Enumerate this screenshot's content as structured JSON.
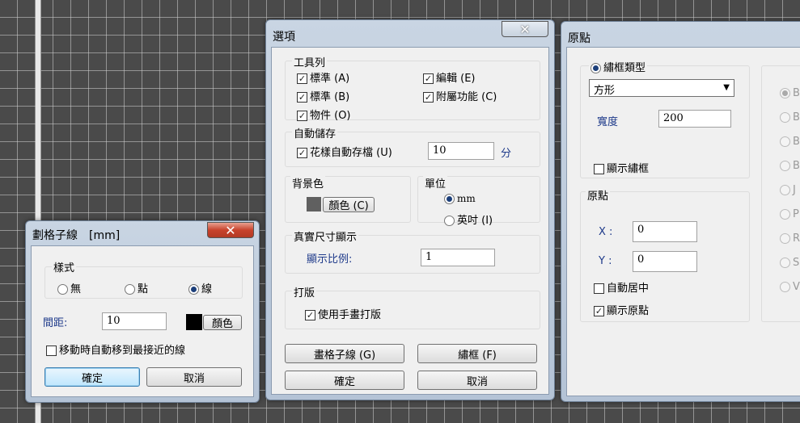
{
  "grid_window": {
    "title": "劃格子線　[mm]",
    "style_label": "樣式",
    "style_options": [
      "無",
      "點",
      "線"
    ],
    "selected_style_index": 2,
    "spacing_label": "間距:",
    "spacing_value": "10",
    "color_button": "顏色",
    "color_value": "#000000",
    "snap_label": "移動時自動移到最接近的線",
    "snap_checked": false,
    "ok_button": "確定",
    "cancel_button": "取消"
  },
  "options_window": {
    "title": "選項",
    "toolbar": {
      "label": "工具列",
      "items": [
        {
          "label": "標準 (A)",
          "checked": true
        },
        {
          "label": "編輯 (E)",
          "checked": true
        },
        {
          "label": "標準 (B)",
          "checked": true
        },
        {
          "label": "附屬功能 (C)",
          "checked": true
        },
        {
          "label": "物件 (O)",
          "checked": true
        }
      ]
    },
    "autosave": {
      "label": "自動儲存",
      "checkbox_label": "花樣自動存檔 (U)",
      "checked": true,
      "value": "10",
      "unit": "分"
    },
    "background": {
      "label": "背景色",
      "button": "顏色 (C)",
      "color_value": "#606060"
    },
    "unit": {
      "label": "單位",
      "options": [
        "mm",
        "英吋 (I)"
      ],
      "selected_index": 0
    },
    "real_size": {
      "label": "真實尺寸顯示",
      "scale_label": "顯示比例:",
      "scale_value": "1"
    },
    "hoop": {
      "label": "打版",
      "checkbox_label": "使用手畫打版",
      "checked": true
    },
    "grid_button": "畫格子線 (G)",
    "frame_button": "繡框 (F)",
    "ok_button": "確定",
    "cancel_button": "取消"
  },
  "origin_window": {
    "title": "原點",
    "frame_type": {
      "radio_label": "繡框類型",
      "selected": "方形",
      "width_label": "寬度",
      "width_value": "200",
      "show_frame_label": "顯示繡框",
      "show_frame_checked": false
    },
    "origin": {
      "label": "原點",
      "x_label": "X :",
      "x_value": "0",
      "y_label": "Y :",
      "y_value": "0",
      "auto_center_label": "自動居中",
      "auto_center_checked": false,
      "show_origin_label": "顯示原點",
      "show_origin_checked": true
    },
    "cut_radios": [
      "B",
      "B",
      "B",
      "B",
      "J",
      "P",
      "R",
      "S",
      "V"
    ]
  }
}
